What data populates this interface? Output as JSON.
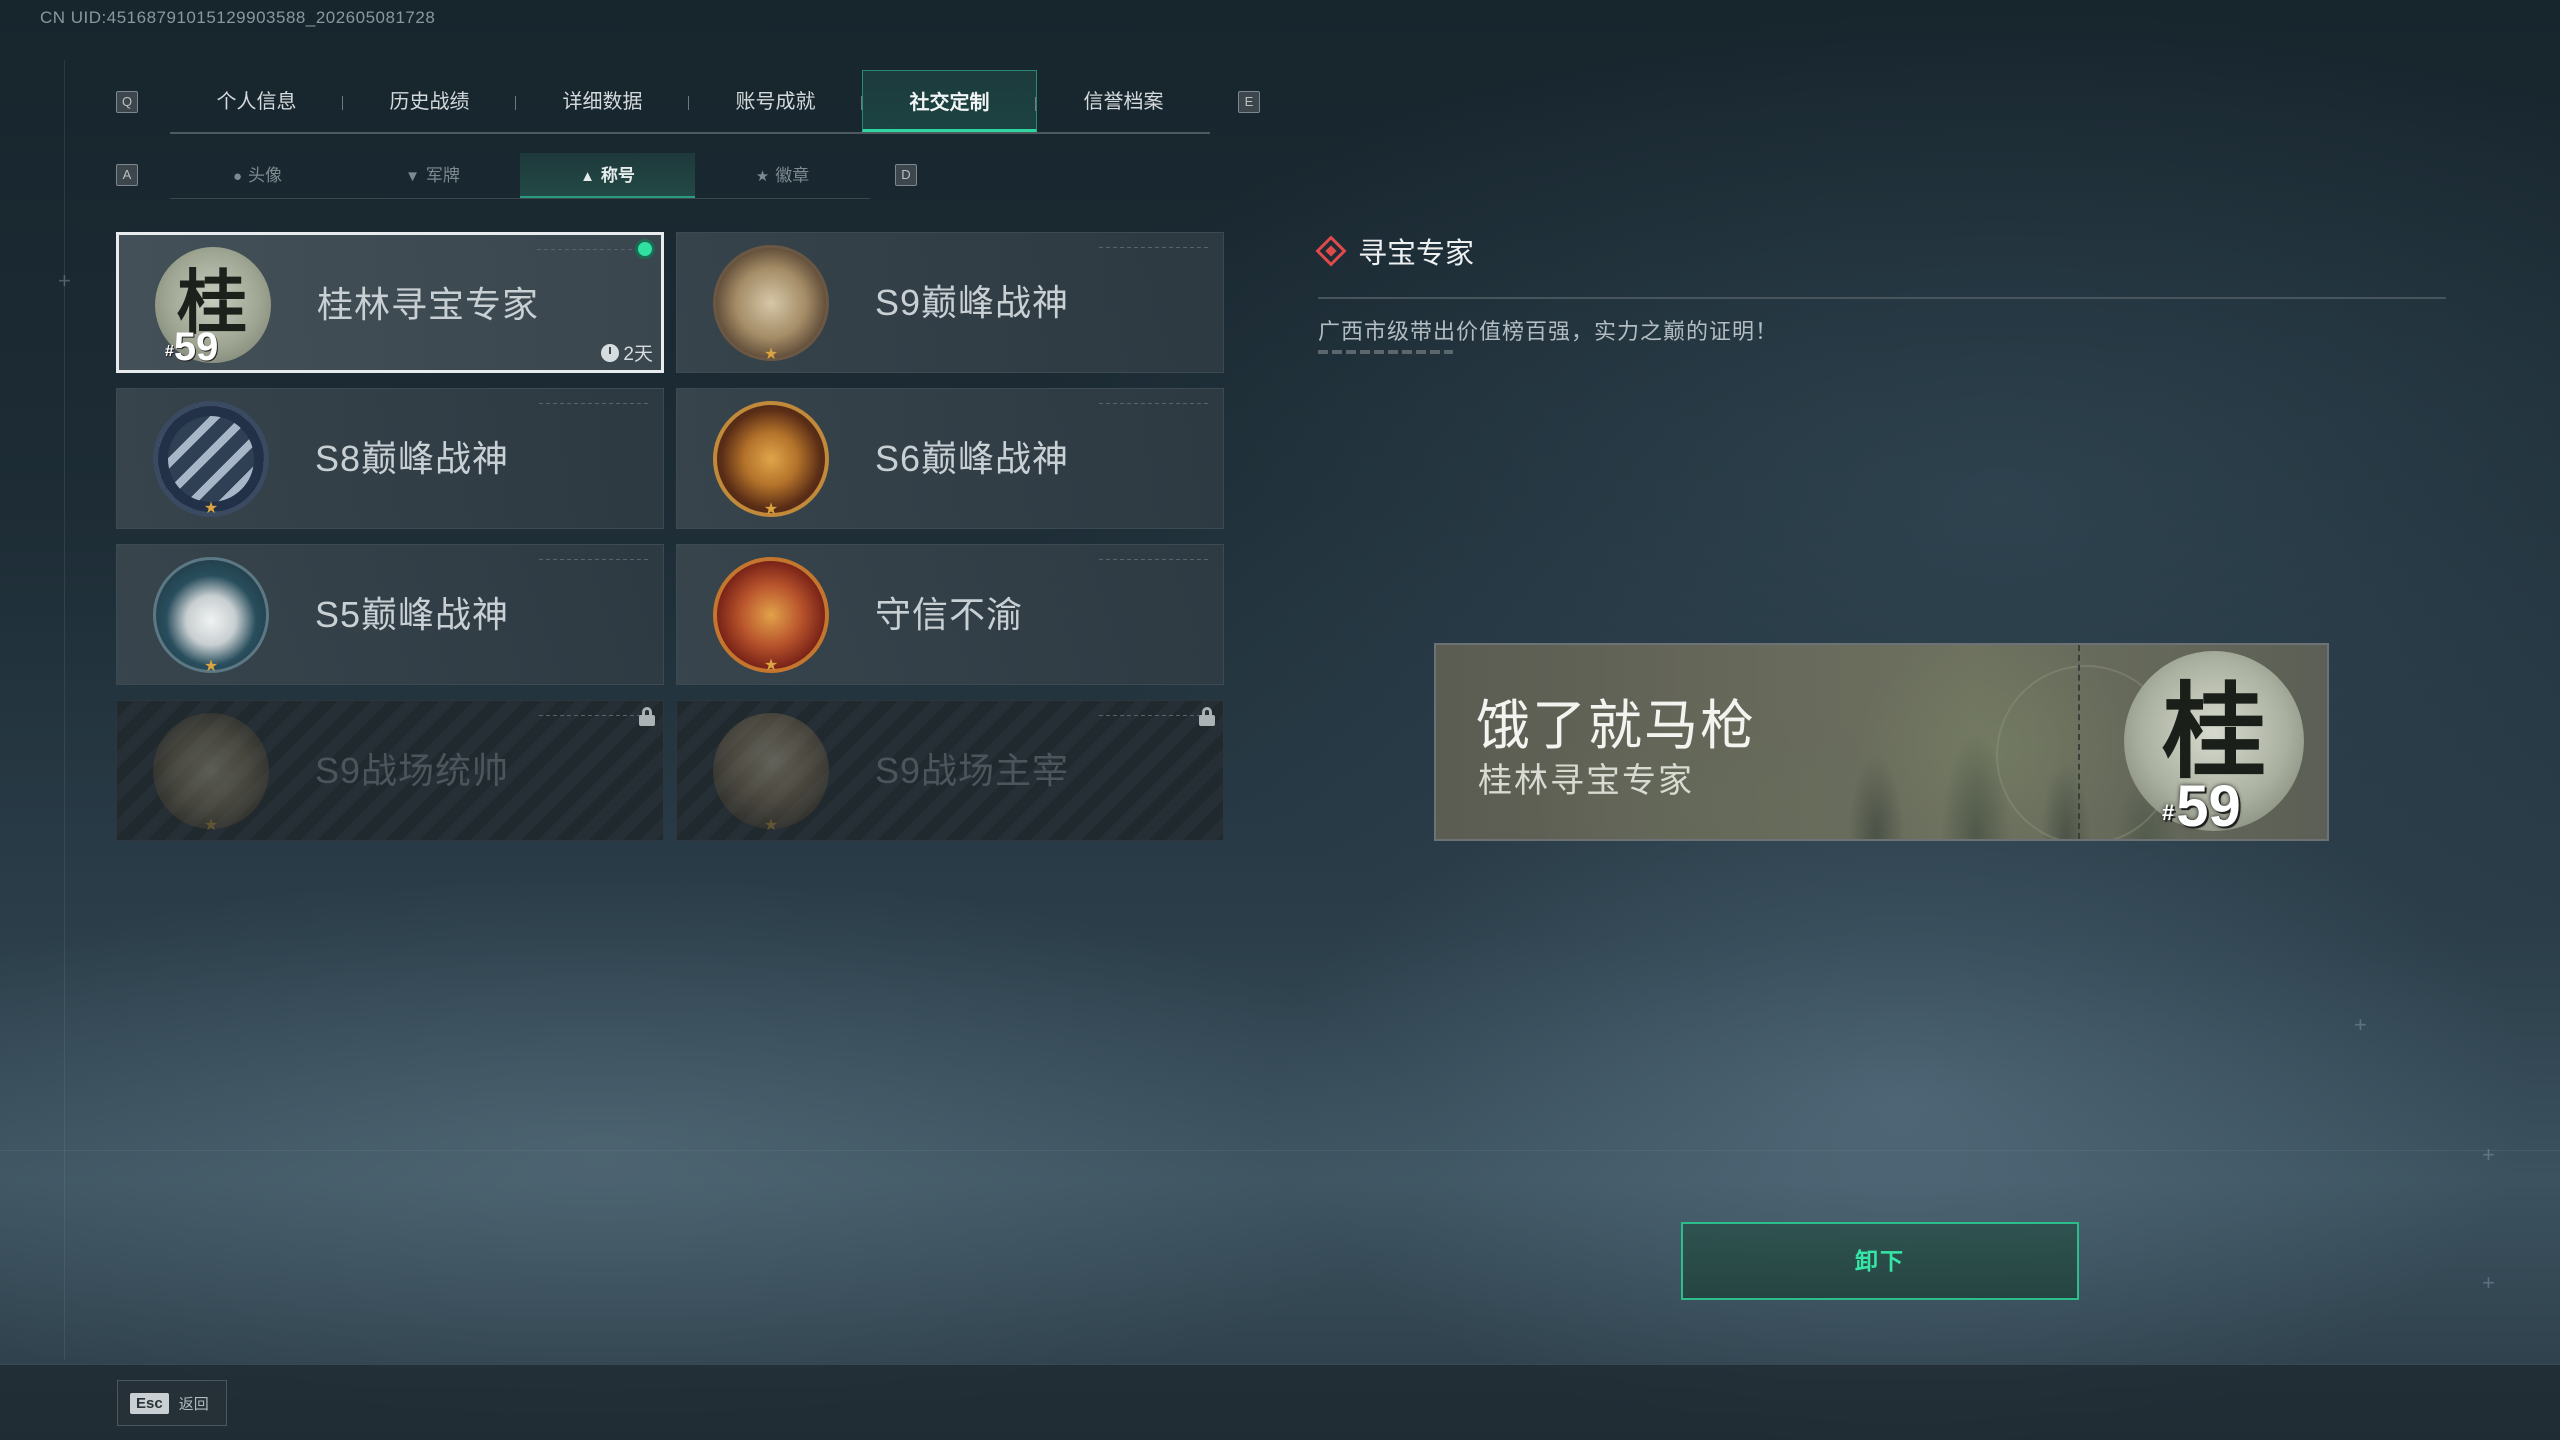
{
  "uid": "CN UID:451687910151299035​88_202605081728",
  "keys": {
    "prev_tab": "Q",
    "next_tab": "E",
    "prev_sub": "A",
    "next_sub": "D"
  },
  "tabs": [
    {
      "label": "个人信息",
      "active": false
    },
    {
      "label": "历史战绩",
      "active": false
    },
    {
      "label": "详细数据",
      "active": false
    },
    {
      "label": "账号成就",
      "active": false
    },
    {
      "label": "社交定制",
      "active": true
    },
    {
      "label": "信誉档案",
      "active": false
    }
  ],
  "subtabs": [
    {
      "label": "头像",
      "icon": "person-icon",
      "active": false
    },
    {
      "label": "军牌",
      "icon": "dogtag-icon",
      "active": false
    },
    {
      "label": "称号",
      "icon": "title-icon",
      "active": true
    },
    {
      "label": "徽章",
      "icon": "badge-icon",
      "active": false
    }
  ],
  "titles": [
    {
      "label": "桂林寻宝专家",
      "emblem": "guilin-59-emblem",
      "selected": true,
      "equipped": true,
      "timer": "2天",
      "locked": false
    },
    {
      "label": "S9巅峰战神",
      "emblem": "building-emblem",
      "selected": false,
      "locked": false
    },
    {
      "label": "S8巅峰战神",
      "emblem": "slash-emblem",
      "selected": false,
      "locked": false
    },
    {
      "label": "S6巅峰战神",
      "emblem": "shield-t-emblem",
      "selected": false,
      "locked": false
    },
    {
      "label": "S5巅峰战神",
      "emblem": "skull-emblem",
      "selected": false,
      "locked": false
    },
    {
      "label": "守信不渝",
      "emblem": "scales-emblem",
      "selected": false,
      "locked": false
    },
    {
      "label": "S9战场统帅",
      "emblem": "warship-emblem",
      "selected": false,
      "locked": true
    },
    {
      "label": "S9战场主宰",
      "emblem": "mushroom-cloud-emblem",
      "selected": false,
      "locked": true
    }
  ],
  "detail": {
    "title": "寻宝专家",
    "description": "广西市级带出价值榜百强，实力之巅的证明！"
  },
  "preview": {
    "player_name": "饿了就马枪",
    "title": "桂林寻宝专家",
    "emblem_char": "桂",
    "rank_prefix": "#",
    "rank_number": "59"
  },
  "card_emblem": {
    "char": "桂",
    "rank_prefix": "#",
    "rank_number": "59"
  },
  "unequip_label": "卸下",
  "footer": {
    "esc_key": "Esc",
    "esc_label": "返回"
  },
  "colors": {
    "accent": "#2fd6a0",
    "diamond": "#e04a4a",
    "star": "#d9a441"
  }
}
